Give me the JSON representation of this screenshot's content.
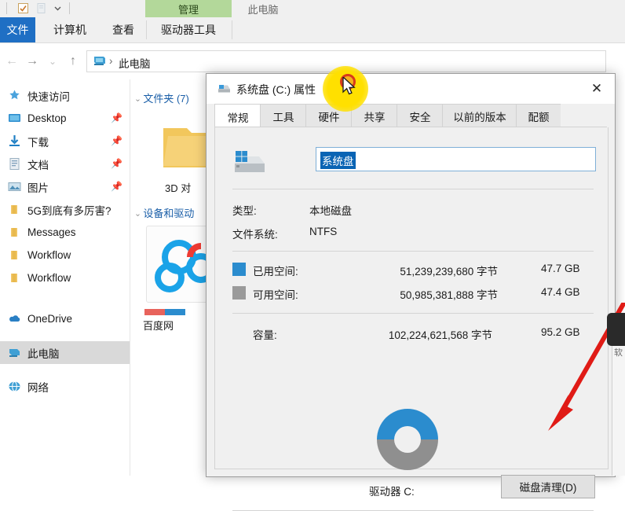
{
  "explorer": {
    "quick_access_toolbar": {
      "icons": [
        "checkbox-icon",
        "properties-icon",
        "customize-chevron-icon"
      ]
    },
    "ribbon": {
      "contextual_header": "管理",
      "window_label": "此电脑",
      "file_tab": "文件",
      "tabs": [
        "计算机",
        "查看",
        "驱动器工具"
      ]
    },
    "address": {
      "back_icon": "back-arrow-icon",
      "forward_icon": "forward-arrow-icon",
      "recent_icon": "chevron-down-icon",
      "up_icon": "up-arrow-icon",
      "computer_icon": "this-pc-icon",
      "separator": "›",
      "crumb": "此电脑"
    },
    "nav_pane": {
      "items": [
        {
          "label": "快速访问",
          "icon": "star-pin-icon",
          "pinned": false,
          "selected": false
        },
        {
          "label": "Desktop",
          "icon": "desktop-icon",
          "pinned": true,
          "selected": false
        },
        {
          "label": "下载",
          "icon": "downloads-icon",
          "pinned": true,
          "selected": false
        },
        {
          "label": "文档",
          "icon": "documents-icon",
          "pinned": true,
          "selected": false
        },
        {
          "label": "图片",
          "icon": "pictures-icon",
          "pinned": true,
          "selected": false
        },
        {
          "label": "5G到底有多厉害?",
          "icon": "folder-icon",
          "pinned": false,
          "selected": false
        },
        {
          "label": "Messages",
          "icon": "folder-icon",
          "pinned": false,
          "selected": false
        },
        {
          "label": "Workflow",
          "icon": "folder-icon",
          "pinned": false,
          "selected": false
        },
        {
          "label": "Workflow",
          "icon": "folder-icon",
          "pinned": false,
          "selected": false
        },
        {
          "label": "OneDrive",
          "icon": "onedrive-cloud-icon",
          "pinned": false,
          "selected": false
        },
        {
          "label": "此电脑",
          "icon": "this-pc-icon",
          "pinned": false,
          "selected": true
        },
        {
          "label": "网络",
          "icon": "network-icon",
          "pinned": false,
          "selected": false
        }
      ]
    },
    "content": {
      "group_folders": "文件夹 (7)",
      "group_devices": "设备和驱动",
      "tile_3d_label": "3D 对",
      "tile_baidu_label": "百度网"
    }
  },
  "dialog": {
    "icon": "drive-icon",
    "title": "系统盘 (C:) 属性",
    "close_label": "✕",
    "tabs": [
      {
        "label": "常规",
        "active": true
      },
      {
        "label": "工具",
        "active": false
      },
      {
        "label": "硬件",
        "active": false
      },
      {
        "label": "共享",
        "active": false
      },
      {
        "label": "安全",
        "active": false
      },
      {
        "label": "以前的版本",
        "active": false
      },
      {
        "label": "配额",
        "active": false
      }
    ],
    "volume_label": {
      "value": "系统盘",
      "selected": true
    },
    "info_rows": [
      {
        "key": "类型:",
        "value": "本地磁盘"
      },
      {
        "key": "文件系统:",
        "value": "NTFS"
      }
    ],
    "space_rows": [
      {
        "key": "已用空间:",
        "bytes": "51,239,239,680 字节",
        "size": "47.7 GB",
        "color": "#2b8cce"
      },
      {
        "key": "可用空间:",
        "bytes": "50,985,381,888 字节",
        "size": "47.4 GB",
        "color": "#9a9a9a"
      }
    ],
    "capacity_row": {
      "key": "容量:",
      "bytes": "102,224,621,568 字节",
      "size": "95.2 GB"
    },
    "drive_caption": "驱动器 C:",
    "cleanup_button": "磁盘清理(D)"
  },
  "annotations": {
    "cursor_highlight": "yellow-click-halo",
    "click_marker": "red-click-ring",
    "pointer": "mouse-cursor-icon",
    "arrow": "red-arrow-annotation",
    "arrow_color": "#e01b16"
  },
  "chart_data": {
    "type": "pie",
    "title": "驱动器 C:",
    "categories": [
      "已用空间",
      "可用空间"
    ],
    "values": [
      47.7,
      47.4
    ],
    "units": "GB",
    "colors": [
      "#2b8cce",
      "#9a9a9a"
    ],
    "total": 95.2,
    "legend": "inline-swatches"
  }
}
